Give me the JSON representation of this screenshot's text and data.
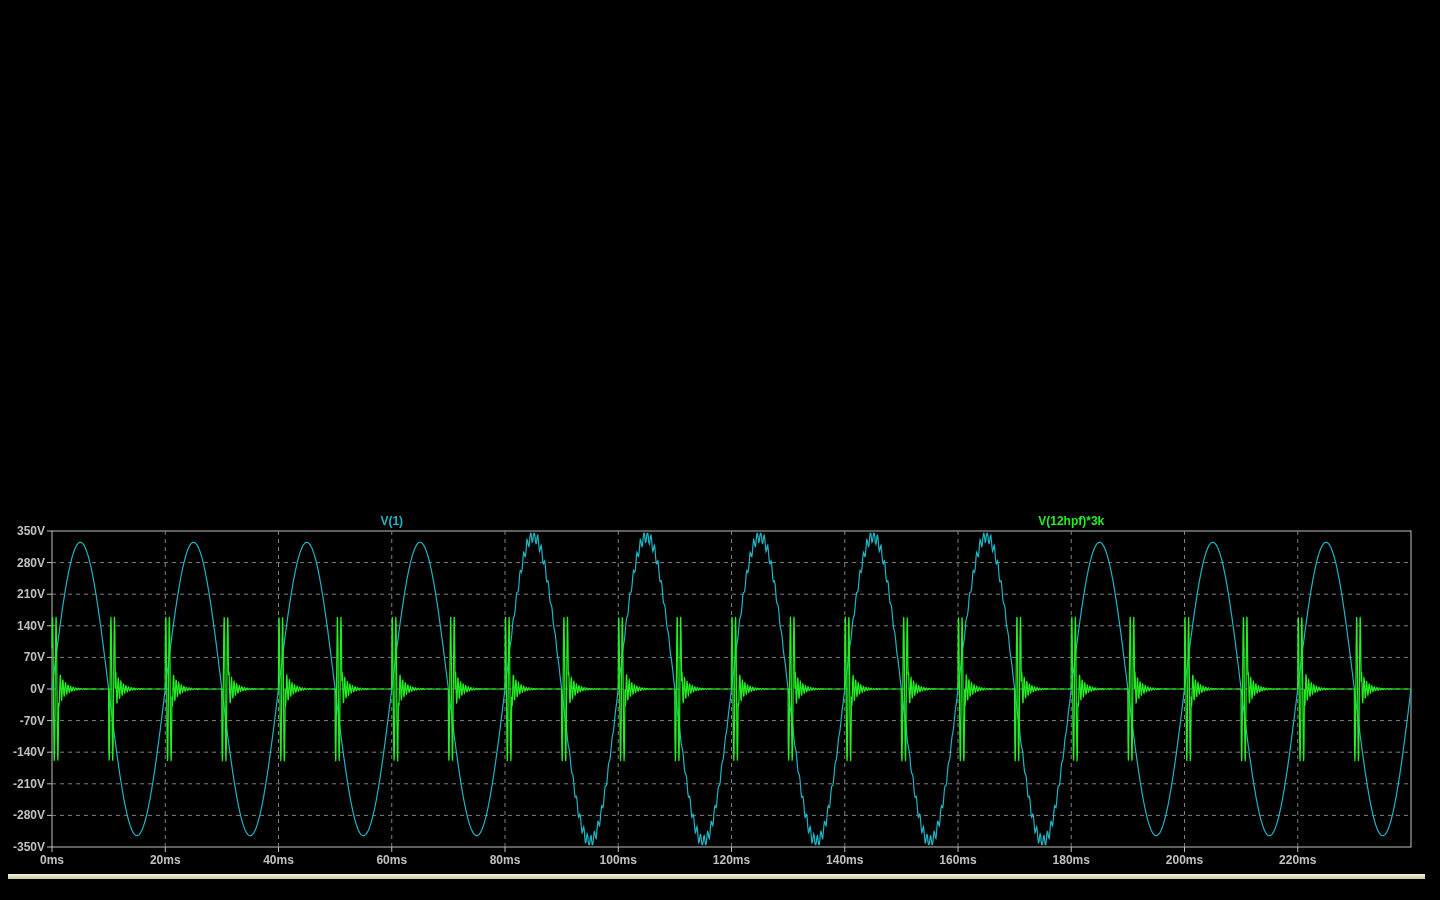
{
  "plot": {
    "traces": [
      {
        "label": "V(1)",
        "color": "#1eb4c4"
      },
      {
        "label": "V(12hpf)*3k",
        "color": "#22ee22"
      }
    ],
    "y_ticks": [
      "350V",
      "280V",
      "210V",
      "140V",
      "70V",
      "0V",
      "-70V",
      "-140V",
      "-210V",
      "-280V",
      "-350V"
    ],
    "x_ticks": [
      "0ms",
      "20ms",
      "40ms",
      "60ms",
      "80ms",
      "100ms",
      "120ms",
      "140ms",
      "160ms",
      "180ms",
      "200ms",
      "220ms"
    ]
  }
}
